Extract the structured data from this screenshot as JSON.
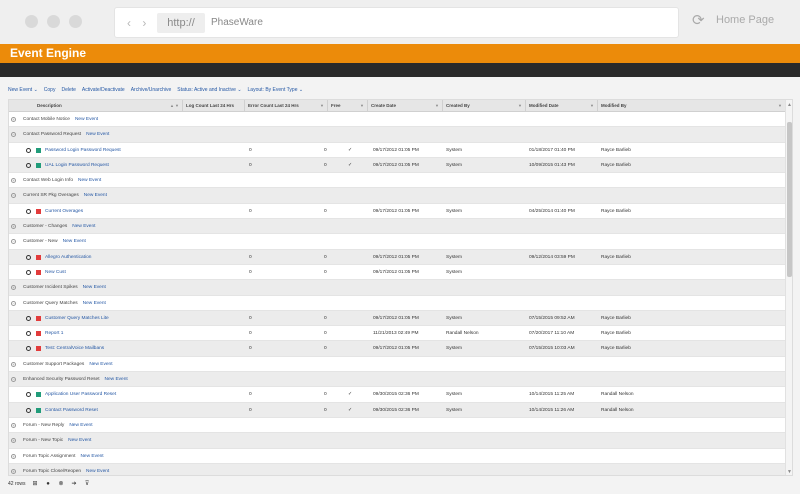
{
  "browser": {
    "nav_arrows": "‹ ›",
    "protocol": "http://",
    "site": "PhaseWare",
    "home_label": "Home Page"
  },
  "app": {
    "title": "Event Engine"
  },
  "toolbar": [
    "New Event ⌄",
    "Copy",
    "Delete",
    "Activate/Deactivate",
    "Archive/Unarchive",
    "Status: Active and Inactive ⌄",
    "Layout: By Event Type ⌄"
  ],
  "columns": {
    "description": "Description",
    "log_count": "Log Count Last 24 Hrs",
    "error_count": "Error Count Last 24 Hrs",
    "free": "Free",
    "create_date": "Create Date",
    "created_by": "Created By",
    "modified_date": "Modified Date",
    "modified_by": "Modified By"
  },
  "new_event_label": "New Event",
  "rows": [
    {
      "type": "group",
      "name": "Contact Mobile Notice",
      "expanded": false
    },
    {
      "type": "group",
      "name": "Contact Password Request",
      "expanded": true
    },
    {
      "type": "item",
      "status": "green",
      "name": "Password Login Password Request",
      "log": "0",
      "err": "0",
      "free": "✓",
      "created": "09/17/2012 01:05 PM",
      "created_by": "System",
      "modified": "01/18/2017 01:40 PM",
      "modified_by": "Rayce Barlieb"
    },
    {
      "type": "item",
      "status": "green",
      "name": "UAL Login Password Request",
      "log": "0",
      "err": "0",
      "free": "✓",
      "created": "09/17/2012 01:05 PM",
      "created_by": "System",
      "modified": "10/09/2015 01:43 PM",
      "modified_by": "Rayce Barlieb"
    },
    {
      "type": "group",
      "name": "Contact Web Login Info",
      "expanded": false
    },
    {
      "type": "group",
      "name": "Current SR Pkg Overages",
      "expanded": true
    },
    {
      "type": "item",
      "status": "red",
      "name": "Current Overages",
      "log": "0",
      "err": "0",
      "free": "",
      "created": "09/17/2012 01:05 PM",
      "created_by": "System",
      "modified": "04/25/2014 01:40 PM",
      "modified_by": "Rayce Barlieb"
    },
    {
      "type": "group",
      "name": "Customer - Changes",
      "expanded": false
    },
    {
      "type": "group",
      "name": "Customer - New",
      "expanded": true
    },
    {
      "type": "item",
      "status": "red",
      "name": "Allegro Authentication",
      "log": "0",
      "err": "0",
      "free": "",
      "created": "09/17/2012 01:05 PM",
      "created_by": "System",
      "modified": "09/12/2014 03:59 PM",
      "modified_by": "Rayce Barlieb"
    },
    {
      "type": "item",
      "status": "red",
      "name": "New Cust",
      "log": "0",
      "err": "0",
      "free": "",
      "created": "09/17/2012 01:05 PM",
      "created_by": "System",
      "modified": "",
      "modified_by": ""
    },
    {
      "type": "group",
      "name": "Customer Incident Spikes",
      "expanded": false
    },
    {
      "type": "group",
      "name": "Customer Query Matches",
      "expanded": true
    },
    {
      "type": "item",
      "status": "red",
      "name": "Customer Query Matches Lite",
      "log": "0",
      "err": "0",
      "free": "",
      "created": "09/17/2012 01:05 PM",
      "created_by": "System",
      "modified": "07/15/2015 09:52 AM",
      "modified_by": "Rayce Barlieb"
    },
    {
      "type": "item",
      "status": "red",
      "name": "Report 1",
      "log": "0",
      "err": "0",
      "free": "",
      "created": "11/21/2013 02:49 PM",
      "created_by": "Randall Nelson",
      "modified": "07/20/2017 11:10 AM",
      "modified_by": "Rayce Barlieb"
    },
    {
      "type": "item",
      "status": "red",
      "name": "Test: CentralVoice Mailbans",
      "log": "0",
      "err": "0",
      "free": "",
      "created": "09/17/2012 01:05 PM",
      "created_by": "System",
      "modified": "07/15/2015 10:03 AM",
      "modified_by": "Rayce Barlieb"
    },
    {
      "type": "group",
      "name": "Customer Support Packages",
      "expanded": false
    },
    {
      "type": "group",
      "name": "Enhanced Security Password Reset",
      "expanded": true
    },
    {
      "type": "item",
      "status": "green",
      "name": "Application User Password Reset",
      "log": "0",
      "err": "0",
      "free": "✓",
      "created": "09/30/2015 02:36 PM",
      "created_by": "System",
      "modified": "10/14/2015 11:25 AM",
      "modified_by": "Randall Nelson"
    },
    {
      "type": "item",
      "status": "green",
      "name": "Contact Password Reset",
      "log": "0",
      "err": "0",
      "free": "✓",
      "created": "09/30/2015 02:36 PM",
      "created_by": "System",
      "modified": "10/14/2015 11:26 AM",
      "modified_by": "Randall Nelson"
    },
    {
      "type": "group",
      "name": "Forum - New Reply",
      "expanded": false
    },
    {
      "type": "group",
      "name": "Forum - New Topic",
      "expanded": false
    },
    {
      "type": "group",
      "name": "Forum Topic Assignment",
      "expanded": false
    },
    {
      "type": "group",
      "name": "Forum Topic Close/Reopen",
      "expanded": false
    }
  ],
  "footer": {
    "count": "42 rows",
    "icons": [
      "filter-grid-icon",
      "check-circle-icon",
      "cancel-circle-icon",
      "export-icon",
      "clear-filter-icon"
    ]
  },
  "colors": {
    "accent": "#ec8b0a",
    "dark_bar": "#2a2a2a",
    "link": "#2457a4",
    "status_green": "#219c7a",
    "status_red": "#e23b3b"
  }
}
